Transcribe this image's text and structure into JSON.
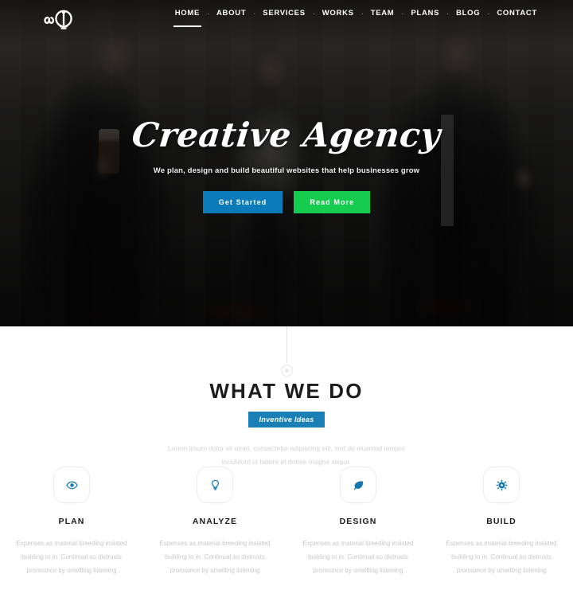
{
  "brand": {
    "logo_icon": "lightbulb-script-monogram-icon",
    "logo_alt": "wi"
  },
  "nav": {
    "separator": "·",
    "items": [
      {
        "label": "HOME",
        "active": true
      },
      {
        "label": "ABOUT",
        "active": false
      },
      {
        "label": "SERVICES",
        "active": false
      },
      {
        "label": "WORKS",
        "active": false
      },
      {
        "label": "TEAM",
        "active": false
      },
      {
        "label": "PLANS",
        "active": false
      },
      {
        "label": "BLOG",
        "active": false
      },
      {
        "label": "CONTACT",
        "active": false
      }
    ]
  },
  "hero": {
    "title": "Creative Agency",
    "subtitle": "We plan, design and build beautiful websites that help businesses grow",
    "primary_button": "Get Started",
    "secondary_button": "Read More",
    "primary_color": "#0a7bb8",
    "secondary_color": "#15cc4e"
  },
  "connector": {
    "marker_icon": "hexagon-dot-icon"
  },
  "what_we_do": {
    "title": "WHAT WE DO",
    "badge": "Inventive Ideas",
    "badge_color": "#1a7fb5",
    "description": "Lorem ipsum dolor sit amet, consectetur adipiscing elit, sed do eiusmod tempor incididunt ut labore et dolore magna aliqua.",
    "features": [
      {
        "icon": "eye-icon",
        "title": "PLAN",
        "text": "Expenses as material breeding insisted building to in. Continual so distrusts pronounce by unwilling listening"
      },
      {
        "icon": "lightbulb-icon",
        "title": "ANALYZE",
        "text": "Expenses as material breeding insisted building to in. Continual so distrusts pronounce by unwilling listening"
      },
      {
        "icon": "leaf-icon",
        "title": "DESIGN",
        "text": "Expenses as material breeding insisted building to in. Continual so distrusts pronounce by unwilling listening"
      },
      {
        "icon": "gear-icon",
        "title": "BUILD",
        "text": "Expenses as material breeding insisted building to in. Continual so distrusts pronounce by unwilling listening"
      }
    ],
    "icon_color": "#1278ad"
  }
}
